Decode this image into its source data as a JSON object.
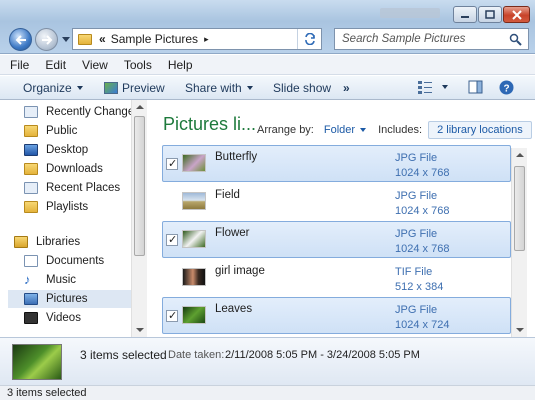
{
  "window": {
    "address": {
      "crumb_prefix": "«",
      "location": "Sample Pictures",
      "arrow": "▸"
    },
    "search_placeholder": "Search Sample Pictures"
  },
  "menu": [
    "File",
    "Edit",
    "View",
    "Tools",
    "Help"
  ],
  "toolbar": {
    "organize": "Organize",
    "preview": "Preview",
    "share_with": "Share with",
    "slide_show": "Slide show",
    "more": "»"
  },
  "nav": {
    "favorites": [
      {
        "label": "Recently Changed",
        "icon": "recent-icon"
      },
      {
        "label": "Public",
        "icon": "folder-icon"
      },
      {
        "label": "Desktop",
        "icon": "desktop-icon"
      },
      {
        "label": "Downloads",
        "icon": "folder-icon"
      },
      {
        "label": "Recent Places",
        "icon": "recent-places-icon"
      },
      {
        "label": "Playlists",
        "icon": "folder-icon"
      }
    ],
    "libraries_label": "Libraries",
    "libraries": [
      {
        "label": "Documents",
        "icon": "documents-icon"
      },
      {
        "label": "Music",
        "icon": "music-icon"
      },
      {
        "label": "Pictures",
        "icon": "pictures-icon",
        "selected": true
      },
      {
        "label": "Videos",
        "icon": "videos-icon"
      }
    ]
  },
  "content": {
    "title": "Pictures li...",
    "arrange_by_label": "Arrange by:",
    "arrange_by_value": "Folder",
    "includes_label": "Includes:",
    "includes_value": "2 library locations",
    "files": [
      {
        "name": "Butterfly",
        "type": "JPG File",
        "dims": "1024 x 768",
        "selected": true,
        "checked": true
      },
      {
        "name": "Field",
        "type": "JPG File",
        "dims": "1024 x 768",
        "selected": false,
        "checked": false
      },
      {
        "name": "Flower",
        "type": "JPG File",
        "dims": "1024 x 768",
        "selected": true,
        "checked": true
      },
      {
        "name": "girl image",
        "type": "TIF File",
        "dims": "512 x 384",
        "selected": false,
        "checked": false
      },
      {
        "name": "Leaves",
        "type": "JPG File",
        "dims": "1024 x 724",
        "selected": true,
        "checked": true
      }
    ]
  },
  "details": {
    "selection": "3 items selected",
    "date_label": "Date taken:",
    "date_value": "2/11/2008 5:05 PM - 3/24/2008 5:05 PM"
  },
  "status": "3 items selected",
  "colors": {
    "accent": "#1e7a3c",
    "link": "#1c5aa6",
    "selection": "#cfe1f6"
  }
}
